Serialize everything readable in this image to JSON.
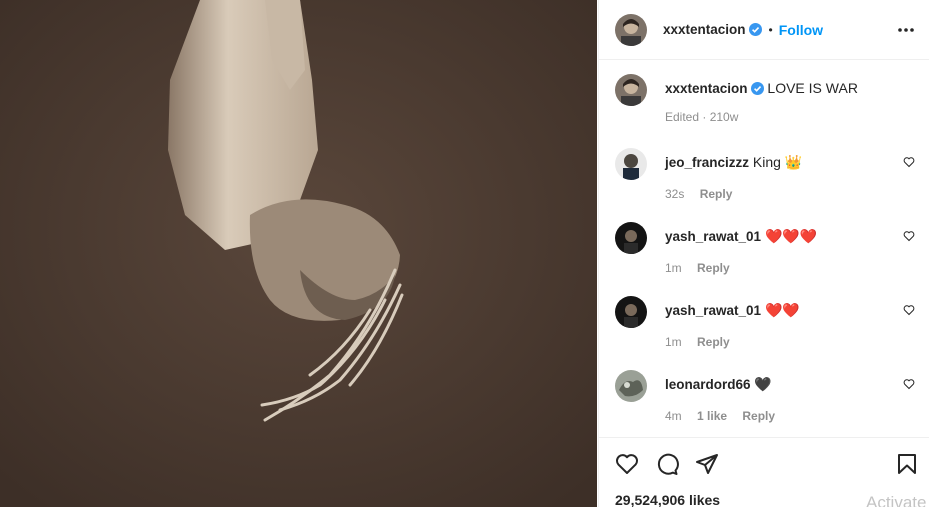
{
  "post": {
    "image_alt": "Upside-down portrait of shirtless man with dreadlocks on brown background",
    "background_color": "#4a3a31"
  },
  "header": {
    "username": "xxxtentacion",
    "separator": "•",
    "follow_label": "Follow"
  },
  "caption": {
    "username": "xxxtentacion",
    "text": "LOVE IS WAR",
    "meta": "Edited · 210w"
  },
  "comments": [
    {
      "username": "jeo_francizzz",
      "text": "King 👑",
      "time": "32s",
      "likes": "",
      "reply": "Reply"
    },
    {
      "username": "yash_rawat_01",
      "text": "❤️❤️❤️",
      "time": "1m",
      "likes": "",
      "reply": "Reply"
    },
    {
      "username": "yash_rawat_01",
      "text": "❤️❤️",
      "time": "1m",
      "likes": "",
      "reply": "Reply"
    },
    {
      "username": "leonardord66",
      "text": "🖤",
      "time": "4m",
      "likes": "1 like",
      "reply": "Reply"
    }
  ],
  "footer": {
    "likes": "29,524,906 likes",
    "watermark": "Activate"
  },
  "colors": {
    "accent": "#0095f6",
    "verified": "#3897f0",
    "text": "#262626",
    "muted": "#8e8e8e"
  },
  "icons": [
    "verified-icon",
    "more-options-icon",
    "heart-icon",
    "comment-icon",
    "share-icon",
    "bookmark-icon"
  ]
}
